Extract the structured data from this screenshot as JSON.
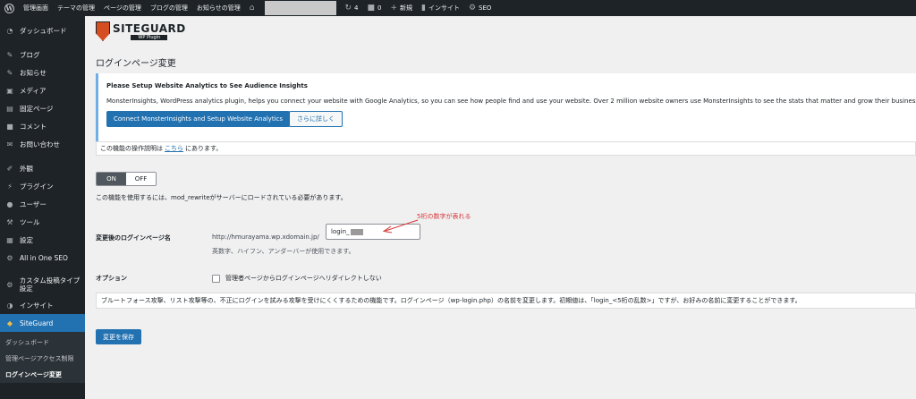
{
  "admin_bar": {
    "items": [
      "管理画面",
      "テーマの管理",
      "ページの管理",
      "ブログの管理",
      "お知らせの管理"
    ],
    "updates_count": "4",
    "comments_count": "0",
    "new_label": "新規",
    "insight_label": "インサイト",
    "seo_label": "SEO"
  },
  "sidebar": {
    "items": [
      {
        "label": "ダッシュボード",
        "icon": "dashboard-icon"
      },
      {
        "label": "ブログ",
        "icon": "pin-icon"
      },
      {
        "label": "お知らせ",
        "icon": "pin-icon"
      },
      {
        "label": "メディア",
        "icon": "media-icon"
      },
      {
        "label": "固定ページ",
        "icon": "page-icon"
      },
      {
        "label": "コメント",
        "icon": "comment-icon"
      },
      {
        "label": "お問い合わせ",
        "icon": "mail-icon"
      },
      {
        "label": "外観",
        "icon": "brush-icon"
      },
      {
        "label": "プラグイン",
        "icon": "plugin-icon"
      },
      {
        "label": "ユーザー",
        "icon": "user-icon"
      },
      {
        "label": "ツール",
        "icon": "wrench-icon"
      },
      {
        "label": "設定",
        "icon": "settings-icon"
      },
      {
        "label": "All in One SEO",
        "icon": "seo-icon"
      },
      {
        "label": "カスタム投稿タイプ設定",
        "icon": "gear-icon"
      },
      {
        "label": "インサイト",
        "icon": "insight-icon"
      },
      {
        "label": "SiteGuard",
        "icon": "siteguard-icon"
      }
    ],
    "sub_items": [
      "ダッシュボード",
      "管理ページアクセス制限",
      "ログインページ変更"
    ]
  },
  "logo": {
    "title": "SITEGUARD",
    "subtitle": "WP Plugin"
  },
  "page_title": "ログインページ変更",
  "notice": {
    "title": "Please Setup Website Analytics to See Audience Insights",
    "body": "MonsterInsights, WordPress analytics plugin, helps you connect your website with Google Analytics, so you can see how people find and use your website. Over 2 million website owners use MonsterInsights to see the stats that matter and grow their business.",
    "primary_button": "Connect MonsterInsights and Setup Website Analytics",
    "secondary_button": "さらに詳しく"
  },
  "manual": {
    "prefix": "この機能の操作説明は",
    "link": "こちら",
    "suffix": "にあります。"
  },
  "toggle": {
    "on": "ON",
    "off": "OFF"
  },
  "warning": "この機能を使用するには、mod_rewriteがサーバーにロードされている必要があります。",
  "login_page": {
    "label": "変更後のログインページ名",
    "url_prefix": "http://hmurayama.wp.xdomain.jp/",
    "value": "login_",
    "help": "英数字、ハイフン、アンダーバーが使用できます。",
    "annotation": "5桁の数字が表れる"
  },
  "option": {
    "label": "オプション",
    "checkbox": "管理者ページからログインページへリダイレクトしない"
  },
  "description": "ブルートフォース攻撃、リスト攻撃等の、不正にログインを試みる攻撃を受けにくくするための機能です。ログインページ（wp-login.php）の名前を変更します。初期値は、「login_<5桁の乱数>」ですが、お好みの名前に変更することができます。",
  "save_button": "変更を保存"
}
